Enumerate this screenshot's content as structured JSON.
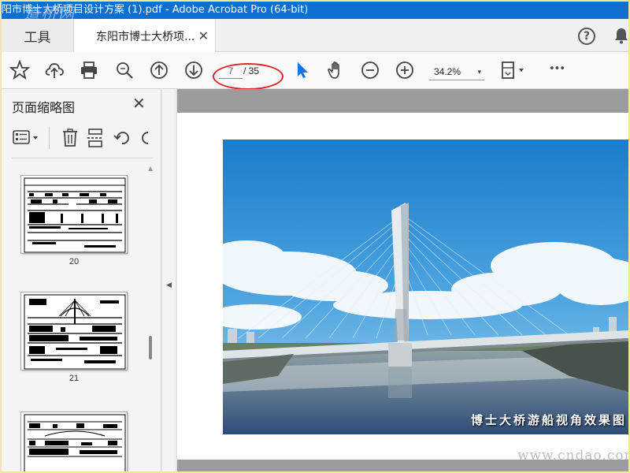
{
  "window": {
    "title": "阳市博士大桥项目设计方案 (1).pdf - Adobe Acrobat Pro (64-bit)",
    "watermark_logo": "道桥网"
  },
  "tabs": {
    "tools_label": "工具",
    "doc_label": "东阳市博士大桥项...",
    "close_glyph": "✕"
  },
  "header_icons": {
    "help": "?",
    "bell": "bell-icon"
  },
  "toolbar": {
    "current_page": "7",
    "total_pages": "/ 35",
    "zoom": "34.2%",
    "zoom_caret": "▾",
    "more": "•••",
    "icons": [
      "star-icon",
      "cloud-upload-icon",
      "print-icon",
      "zoom-search-icon",
      "page-up-icon",
      "page-down-icon",
      "select-arrow-icon",
      "hand-icon",
      "zoom-out-icon",
      "zoom-in-icon",
      "page-fit-icon",
      "more-icon"
    ]
  },
  "sidebar": {
    "title": "页面缩略图",
    "close_glyph": "✕",
    "thumbnails": [
      {
        "page": "20"
      },
      {
        "page": "21"
      },
      {
        "page": ""
      }
    ]
  },
  "collapse_glyph": "◀",
  "document": {
    "caption": "博士大桥游船视角效果图"
  },
  "watermark_site": "www.cndao.com",
  "colors": {
    "titlebar": "#0d6fd1",
    "accent_blue": "#1473e6",
    "annotation_red": "#e0252a"
  }
}
